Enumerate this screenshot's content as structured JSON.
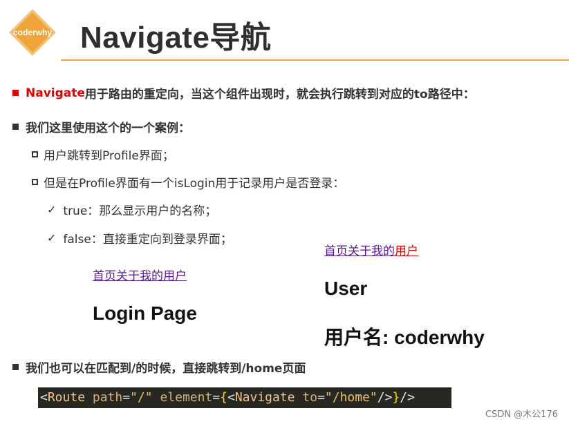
{
  "logo": {
    "text": "coderwhy",
    "color": "#f0a53a"
  },
  "title": "Navigate导航",
  "bullets": {
    "b1_highlight": "Navigate",
    "b1_rest": "用于路由的重定向，当这个组件出现时，就会执行跳转到对应的to路径中：",
    "b2": "我们这里使用这个的一个案例：",
    "b3": "我们也可以在匹配到/的时候，直接跳转到/home页面"
  },
  "subs": {
    "s1": "用户跳转到Profile界面；",
    "s2": "但是在Profile界面有一个isLogin用于记录用户是否登录："
  },
  "checks": {
    "c1": "true：那么显示用户的名称；",
    "c2": "false：直接重定向到登录界面；"
  },
  "demo_left": {
    "nav": [
      "首页",
      "关于",
      "我的",
      "用户"
    ],
    "heading": "Login Page"
  },
  "demo_right": {
    "nav": [
      "首页",
      "关于",
      "我的",
      "用户"
    ],
    "heading": "User",
    "username": "用户名: coderwhy"
  },
  "code": {
    "open": "<",
    "tag": "Route",
    "attr1": "path",
    "eq1": "=",
    "val1": "\"/\"",
    "attr2": "element",
    "eq2": "=",
    "brace_open": "{",
    "inner_open": "<",
    "inner_tag": "Navigate",
    "attr3": "to",
    "eq3": "=",
    "val3": "\"/home\"",
    "inner_close": "/>",
    "brace_close": "}",
    "close": "/>"
  },
  "credit": "CSDN @木公176"
}
